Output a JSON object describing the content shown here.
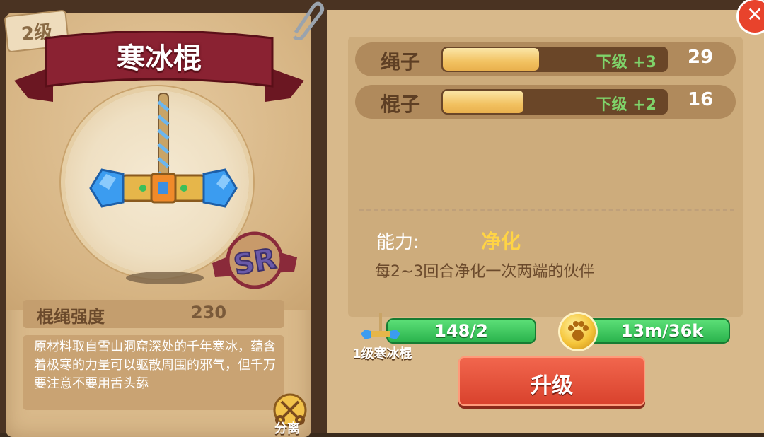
{
  "item": {
    "level_tag": "2级",
    "name": "寒冰棍",
    "rarity": "SR",
    "stat_label": "棍绳强度",
    "stat_value": "230",
    "description": "原材料取自雪山洞窟深处的千年寒冰，蕴含着极寒的力量可以驱散周围的邪气，但千万要注意不要用舌头舔",
    "split_label": "分离"
  },
  "resources": [
    {
      "label": "绳子",
      "bonus": "下级 +3",
      "count": "29",
      "fill": 0.43
    },
    {
      "label": "棍子",
      "bonus": "下级 +2",
      "count": "16",
      "fill": 0.36
    }
  ],
  "ability": {
    "label": "能力:",
    "name": "净化",
    "description": "每2~3回合净化一次两端的伙伴"
  },
  "materials": {
    "item_count": "148/2",
    "item_label": "1级寒冰棍",
    "coin_count": "13m/36k"
  },
  "actions": {
    "upgrade_label": "升级",
    "close_icon": "close-icon"
  },
  "colors": {
    "ribbon": "#8a2232",
    "green": "#2fbf55",
    "upgrade": "#e0533a",
    "ability_name": "#ffd445"
  }
}
